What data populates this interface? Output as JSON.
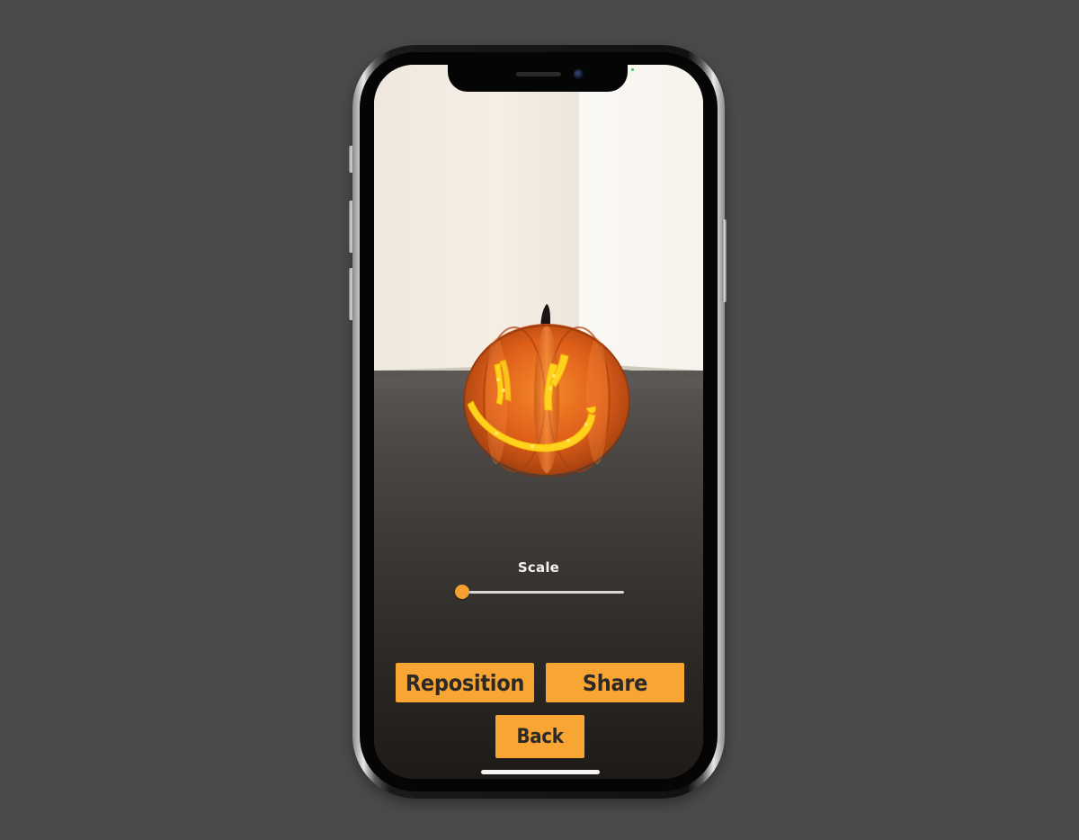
{
  "app": {
    "scene_object": "pumpkin"
  },
  "controls": {
    "scale_label": "Scale",
    "scale_value": 0.0
  },
  "buttons": {
    "reposition_label": "Reposition",
    "share_label": "Share",
    "back_label": "Back"
  },
  "colors": {
    "accent": "#f8a533",
    "background": "#4a4a4a",
    "pumpkin": "#e2651a",
    "carving_glow": "#ffd21e"
  },
  "icons": {
    "camera": "front-camera-icon",
    "home": "home-indicator"
  }
}
